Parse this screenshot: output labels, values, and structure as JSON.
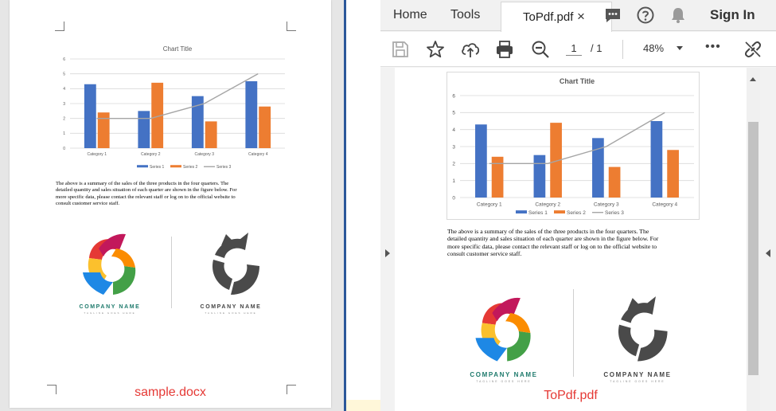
{
  "chart_data": [
    {
      "type": "bar",
      "title": "Chart Title",
      "categories": [
        "Category 1",
        "Category 2",
        "Category 3",
        "Category 4"
      ],
      "series": [
        {
          "name": "Series 1",
          "values": [
            4.3,
            2.5,
            3.5,
            4.5
          ],
          "color": "#4472c4"
        },
        {
          "name": "Series 2",
          "values": [
            2.4,
            4.4,
            1.8,
            2.8
          ],
          "color": "#ed7d31"
        },
        {
          "name": "Series 3",
          "type": "line",
          "values": [
            2,
            2,
            3,
            5
          ],
          "color": "#a5a5a5"
        }
      ],
      "ylim": [
        0,
        6
      ],
      "yticks": [
        "0",
        "1",
        "2",
        "3",
        "4",
        "5",
        "6"
      ],
      "grid": true,
      "legend": "bottom"
    },
    {
      "type": "bar",
      "title": "Chart Title",
      "categories": [
        "Category 1",
        "Category 2",
        "Category 3",
        "Category 4"
      ],
      "series": [
        {
          "name": "Series 1",
          "values": [
            4.3,
            2.5,
            3.5,
            4.5
          ],
          "color": "#4472c4"
        },
        {
          "name": "Series 2",
          "values": [
            2.4,
            4.4,
            1.8,
            2.8
          ],
          "color": "#ed7d31"
        },
        {
          "name": "Series 3",
          "type": "line",
          "values": [
            2,
            2,
            3,
            5
          ],
          "color": "#a5a5a5"
        }
      ],
      "ylim": [
        0,
        6
      ],
      "yticks": [
        "0",
        "1",
        "2",
        "3",
        "4",
        "5",
        "6"
      ],
      "grid": true,
      "legend": "bottom"
    }
  ],
  "word_doc": {
    "caption": "sample.docx",
    "paragraph": [
      "The above is a summary of the sales of the three products in the four quarters. The",
      "detailed quantity and sales situation of each quarter are shown in the figure below. For",
      "more specific data, please contact the relevant staff or log on to the official website to",
      "consult customer service staff."
    ]
  },
  "pdf_doc": {
    "caption": "ToPdf.pdf",
    "paragraph": [
      "The above is a summary of the sales of the three products in the four quarters. The",
      "detailed quantity and sales situation of each quarter are shown in the figure below. For",
      "more specific data, please contact the relevant staff or log on to the official website to",
      "consult customer service staff."
    ]
  },
  "logos": {
    "color_name": "COMPANY NAME",
    "color_tagline": "TAGLINE GOES HERE",
    "mono_name": "COMPANY NAME",
    "mono_tagline": "TAGLINE GOES HERE",
    "name_color": "#1e7a6c",
    "mono_color": "#444444"
  },
  "viewer": {
    "menu": {
      "home": "Home",
      "tools": "Tools",
      "tab": "ToPdf.pdf",
      "tab_close": "×",
      "sign_in": "Sign In"
    },
    "toolbar": {
      "page_current": "1",
      "page_total": "/ 1",
      "zoom": "48%",
      "more": "•••"
    },
    "icons": [
      "save-icon",
      "star-icon",
      "upload-icon",
      "print-icon",
      "zoom-out-icon",
      "comment-icon",
      "help-icon",
      "bell-icon",
      "link-icon"
    ]
  }
}
